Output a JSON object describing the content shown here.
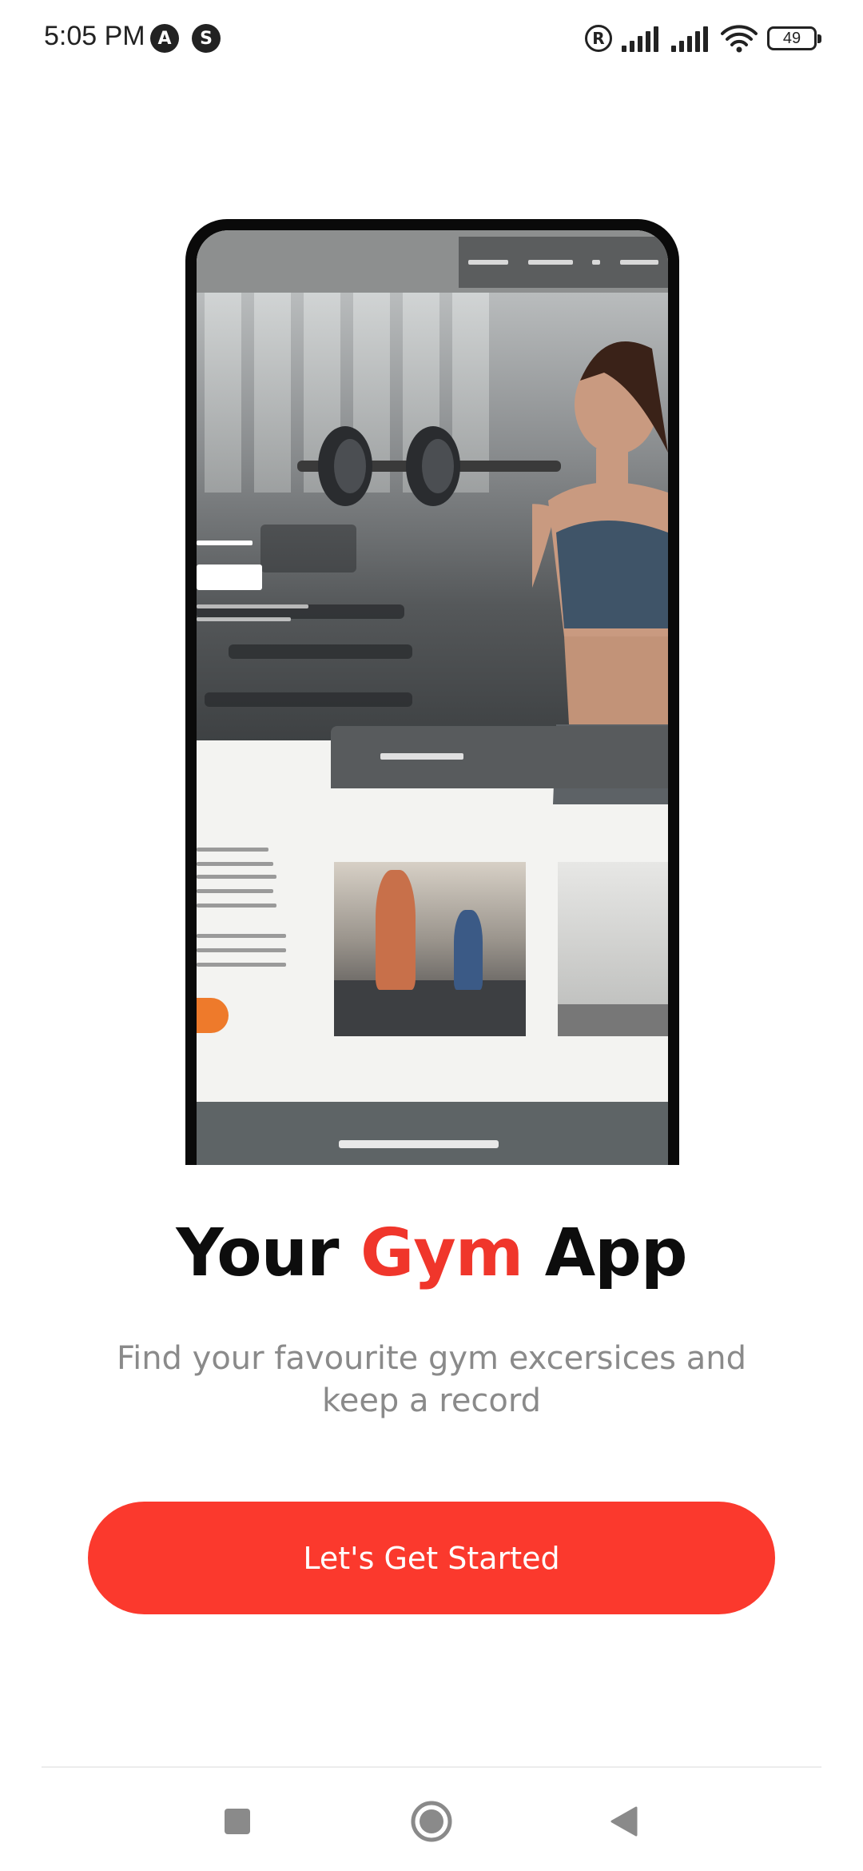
{
  "status_bar": {
    "time": "5:05 PM",
    "app_icon_1": "A",
    "app_icon_2": "S",
    "registered_icon": "R",
    "battery_level": "49",
    "icons": [
      "a-notification-icon",
      "s-notification-icon",
      "registered-icon",
      "signal-icon",
      "signal-icon",
      "wifi-icon",
      "battery-icon"
    ]
  },
  "hero_image": {
    "description_icon": "gym-app-mockup-image"
  },
  "headline": {
    "part1": "Your ",
    "accent": "Gym",
    "part2": " App"
  },
  "subtitle": "Find your favourite gym excersices and keep a record",
  "cta": {
    "label": "Let's Get Started"
  },
  "nav_bar": {
    "items": [
      "recent-apps-icon",
      "home-icon",
      "back-icon"
    ]
  },
  "colors": {
    "accent": "#f0362b",
    "button": "#fb392d",
    "subtitle": "#8a8a8a",
    "headline": "#0d0d0d"
  }
}
